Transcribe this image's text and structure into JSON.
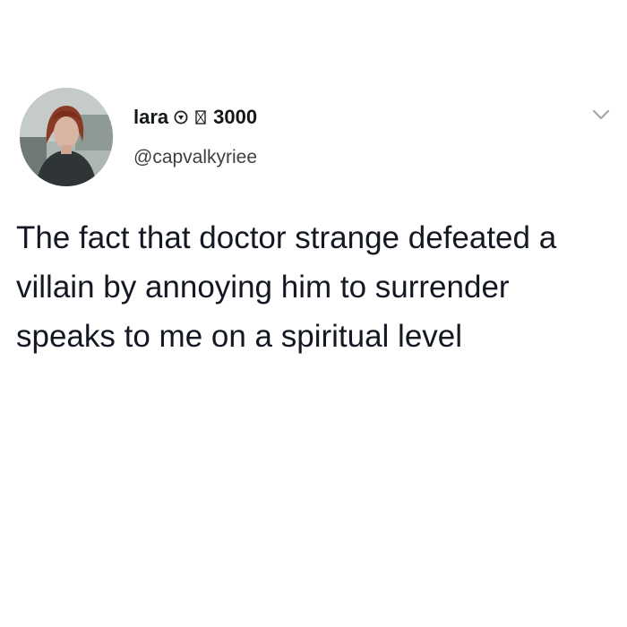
{
  "tweet": {
    "display_name": "lara",
    "name_score": "3000",
    "handle": "@capvalkyriee",
    "body": "The fact that doctor strange defeated a villain by annoying him to surrender speaks to me on a spiritual level",
    "icons": {
      "name_badge": "shield-emoji-icon",
      "name_emoji": "missing-glyph-icon",
      "menu": "chevron-down-icon"
    },
    "colors": {
      "text": "#141823",
      "handle": "#3c3f44",
      "caret": "#a8a8a8"
    }
  }
}
